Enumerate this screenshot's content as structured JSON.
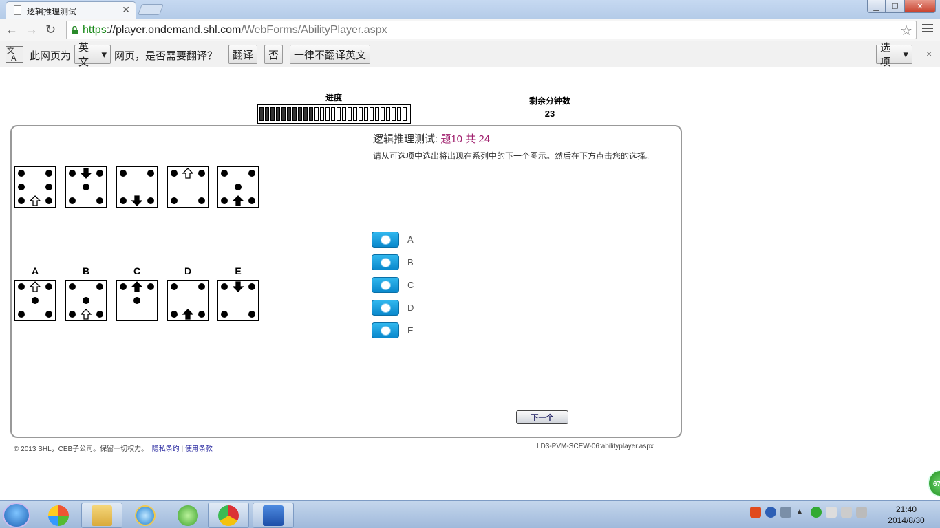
{
  "browser": {
    "tab_title": "逻辑推理测试",
    "tab_close": "✕",
    "url_scheme": "https",
    "url_host": "://player.ondemand.shl.com",
    "url_path": "/WebForms/AbilityPlayer.aspx"
  },
  "translate_bar": {
    "prefix": "此网页为",
    "language": "英文",
    "suffix": "网页，是否需要翻译？",
    "translate_button": "翻译",
    "no_button": "否",
    "never_button": "一律不翻译英文",
    "options_button": "选项",
    "close": "×"
  },
  "header": {
    "progress_label": "进度",
    "progress_fraction": 0.38,
    "time_label": "剩余分钟数",
    "time_value": "23"
  },
  "question": {
    "title_prefix": "逻辑推理测试: ",
    "title_num": "题10 共 24",
    "instruction": "请从可选项中选出将出现在系列中的下一个图示。然后在下方点击您的选择。"
  },
  "series": [
    {
      "dots": [
        "tl",
        "tr",
        "ml",
        "mr",
        "bl",
        "br"
      ],
      "arrow": {
        "pos": "bc",
        "dir": "up",
        "filled": false
      }
    },
    {
      "dots": [
        "tl",
        "tr",
        "c",
        "bl",
        "br"
      ],
      "arrow": {
        "pos": "tc",
        "dir": "down",
        "filled": true
      }
    },
    {
      "dots": [
        "tl",
        "tr",
        "bl",
        "br"
      ],
      "arrow": {
        "pos": "bc",
        "dir": "down",
        "filled": true
      }
    },
    {
      "dots": [
        "tl",
        "tr",
        "bl",
        "br"
      ],
      "arrow": {
        "pos": "tc",
        "dir": "up",
        "filled": false
      }
    },
    {
      "dots": [
        "tl",
        "tr",
        "c",
        "bl",
        "br"
      ],
      "arrow": {
        "pos": "bc",
        "dir": "up",
        "filled": true
      }
    }
  ],
  "options": [
    {
      "letter": "A",
      "dots": [
        "tl",
        "tr",
        "c",
        "bl",
        "br"
      ],
      "arrow": {
        "pos": "tc",
        "dir": "up",
        "filled": false
      }
    },
    {
      "letter": "B",
      "dots": [
        "tl",
        "tr",
        "c",
        "bl",
        "br"
      ],
      "arrow": {
        "pos": "bc",
        "dir": "up",
        "filled": false
      }
    },
    {
      "letter": "C",
      "dots": [
        "tl",
        "tr",
        "c"
      ],
      "arrow": {
        "pos": "tc",
        "dir": "up",
        "filled": true
      }
    },
    {
      "letter": "D",
      "dots": [
        "tl",
        "tr",
        "bl",
        "br"
      ],
      "arrow": {
        "pos": "bc",
        "dir": "up",
        "filled": true
      }
    },
    {
      "letter": "E",
      "dots": [
        "tl",
        "tr",
        "bl",
        "br"
      ],
      "arrow": {
        "pos": "tc",
        "dir": "down",
        "filled": true
      }
    }
  ],
  "answers": [
    "A",
    "B",
    "C",
    "D",
    "E"
  ],
  "next_button": "下一个",
  "footer": {
    "copyright": "© 2013 SHL，CEB子公司。保留一切权力。",
    "privacy": "隐私条约",
    "separator": "|",
    "terms": "使用条款",
    "page_id": "LD3-PVM-SCEW-06:abilityplayer.aspx"
  },
  "side_badge": "67",
  "clock": {
    "time": "21:40",
    "date": "2014/8/30"
  },
  "colors": {
    "accent": "#0a88cc",
    "question_num": "#a0206e"
  }
}
